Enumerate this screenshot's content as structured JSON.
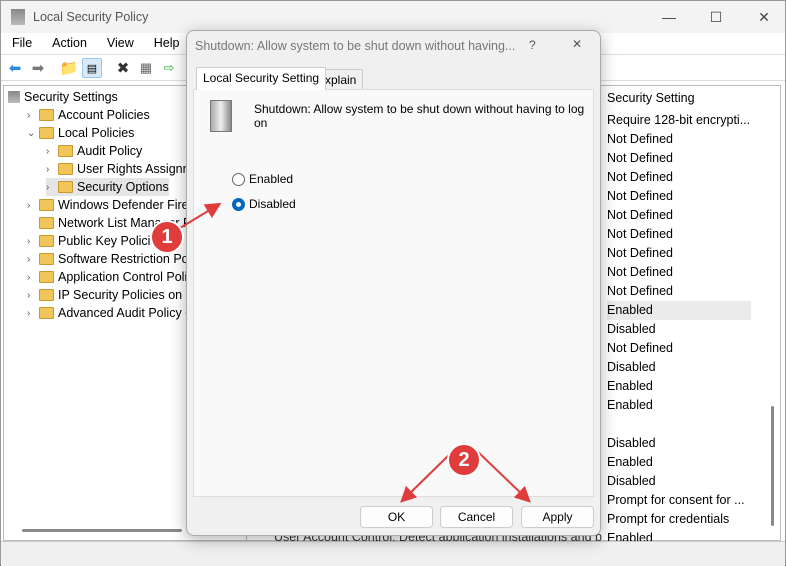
{
  "window": {
    "title": "Local Security Policy",
    "minimize": "—",
    "maximize": "☐",
    "close": "✕"
  },
  "menu": [
    "File",
    "Action",
    "View",
    "Help"
  ],
  "tree": [
    {
      "label": "Security Settings",
      "level": 0,
      "chev": ""
    },
    {
      "label": "Account Policies",
      "level": 1,
      "chev": "›"
    },
    {
      "label": "Local Policies",
      "level": 1,
      "chev": "⌄"
    },
    {
      "label": "Audit Policy",
      "level": 2,
      "chev": "›"
    },
    {
      "label": "User Rights Assignment",
      "level": 2,
      "chev": "›"
    },
    {
      "label": "Security Options",
      "level": 2,
      "chev": "›",
      "selected": true
    },
    {
      "label": "Windows Defender Firewall",
      "level": 1,
      "chev": "›"
    },
    {
      "label": "Network List Manager Policies",
      "level": 1,
      "chev": ""
    },
    {
      "label": "Public Key Policies",
      "level": 1,
      "chev": "›"
    },
    {
      "label": "Software Restriction Policies",
      "level": 1,
      "chev": "›"
    },
    {
      "label": "Application Control Policies",
      "level": 1,
      "chev": "›"
    },
    {
      "label": "IP Security Policies on Local Computer",
      "level": 1,
      "chev": "›"
    },
    {
      "label": "Advanced Audit Policy Configuration",
      "level": 1,
      "chev": "›"
    }
  ],
  "list": {
    "header": "Security Setting",
    "rows": [
      "Require 128-bit encrypti...",
      "Not Defined",
      "Not Defined",
      "Not Defined",
      "Not Defined",
      "Not Defined",
      "Not Defined",
      "Not Defined",
      "Not Defined",
      "Not Defined",
      "Enabled",
      "Disabled",
      "Not Defined",
      "Disabled",
      "Enabled",
      "Enabled",
      "",
      "Disabled",
      "Enabled",
      "Disabled",
      "Prompt for consent for ...",
      "Prompt for credentials",
      "Enabled"
    ],
    "hidden_policy": "User Account Control: Detect application installations and p"
  },
  "dialog": {
    "title": "Shutdown: Allow system to be shut down without having...",
    "help": "?",
    "close": "✕",
    "tabs": [
      "Local Security Setting",
      "Explain"
    ],
    "policy": "Shutdown: Allow system to be shut down without having to log on",
    "options": [
      "Enabled",
      "Disabled"
    ],
    "selected": "Disabled",
    "buttons": {
      "ok": "OK",
      "cancel": "Cancel",
      "apply": "Apply"
    }
  },
  "annotations": [
    "1",
    "2"
  ],
  "colors": {
    "accent": "#0067c0",
    "annotation": "#e03c3c"
  }
}
